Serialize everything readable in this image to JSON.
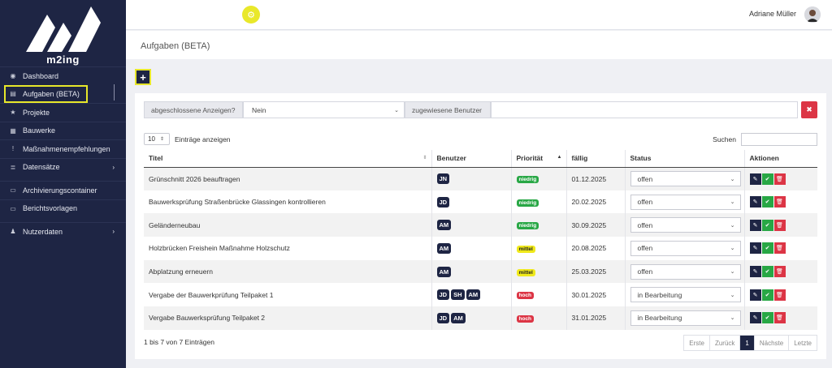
{
  "brand": {
    "name": "m2ing"
  },
  "sidebar": {
    "items": [
      {
        "label": "Dashboard",
        "icon": "dashboard-icon",
        "glyph": "◉"
      },
      {
        "label": "Aufgaben (BETA)",
        "icon": "tasks-icon",
        "glyph": "▤",
        "active": true
      },
      {
        "label": "Projekte",
        "icon": "star-icon",
        "glyph": "★"
      },
      {
        "label": "Bauwerke",
        "icon": "building-icon",
        "glyph": "▦"
      },
      {
        "label": "Maßnahmenempfehlungen",
        "icon": "exclamation-icon",
        "glyph": "!"
      },
      {
        "label": "Datensätze",
        "icon": "database-icon",
        "glyph": "≣",
        "chevron": "›"
      },
      {
        "label": "Archivierungscontainer",
        "icon": "archive-icon",
        "glyph": "▭"
      },
      {
        "label": "Berichtsvorlagen",
        "icon": "report-icon",
        "glyph": "▭"
      },
      {
        "label": "Nutzerdaten",
        "icon": "user-icon",
        "glyph": "♟",
        "chevron": "›"
      }
    ]
  },
  "topbar": {
    "user_name": "Adriane Müller",
    "settings_glyph": "⚙"
  },
  "page": {
    "title": "Aufgaben (BETA)",
    "add_glyph": "+"
  },
  "filters": {
    "completed_label": "abgeschlossene Anzeigen?",
    "completed_value": "Nein",
    "assigned_label": "zugewiesene Benutzer",
    "clear_glyph": "✖"
  },
  "table_controls": {
    "length_value": "10",
    "length_label": "Einträge anzeigen",
    "search_label": "Suchen"
  },
  "table": {
    "headers": [
      "Titel",
      "Benutzer",
      "Priorität",
      "fällig",
      "Status",
      "Aktionen"
    ],
    "rows": [
      {
        "title": "Grünschnitt 2026 beauftragen",
        "users": [
          "JN"
        ],
        "priority": "niedrig",
        "due": "01.12.2025",
        "status": "offen"
      },
      {
        "title": "Bauwerksprüfung Straßenbrücke Glassingen kontrollieren",
        "users": [
          "JD"
        ],
        "priority": "niedrig",
        "due": "20.02.2025",
        "status": "offen"
      },
      {
        "title": "Geländerneubau",
        "users": [
          "AM"
        ],
        "priority": "niedrig",
        "due": "30.09.2025",
        "status": "offen"
      },
      {
        "title": "Holzbrücken Freishein Maßnahme Holzschutz",
        "users": [
          "AM"
        ],
        "priority": "mittel",
        "due": "20.08.2025",
        "status": "offen"
      },
      {
        "title": "Abplatzung erneuern",
        "users": [
          "AM"
        ],
        "priority": "mittel",
        "due": "25.03.2025",
        "status": "offen"
      },
      {
        "title": "Vergabe der Bauwerkprüfung Teilpaket 1",
        "users": [
          "JD",
          "SH",
          "AM"
        ],
        "priority": "hoch",
        "due": "30.01.2025",
        "status": "in Bearbeitung"
      },
      {
        "title": "Vergabe Bauwerksprüfung Teilpaket 2",
        "users": [
          "JD",
          "AM"
        ],
        "priority": "hoch",
        "due": "31.01.2025",
        "status": "in Bearbeitung"
      }
    ]
  },
  "footer": {
    "info": "1 bis 7 von 7 Einträgen",
    "pager": [
      "Erste",
      "Zurück",
      "1",
      "Nächste",
      "Letzte"
    ],
    "current_page": "1"
  },
  "colors": {
    "sidebar": "#1e2544",
    "accent": "#e7e72a",
    "danger": "#dc3545",
    "success": "#28a745"
  }
}
